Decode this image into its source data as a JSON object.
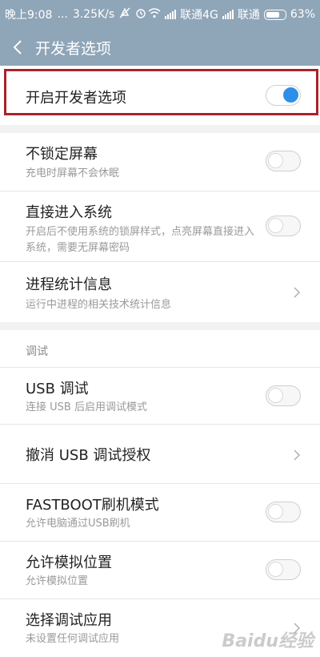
{
  "status_bar": {
    "time": "晚上9:08",
    "dots": "...",
    "speed": "3.25K/s",
    "carrier1": "联通4G",
    "carrier2": "联通",
    "battery": "63%"
  },
  "app_bar": {
    "title": "开发者选项"
  },
  "master_toggle": {
    "label": "开启开发者选项",
    "on": true
  },
  "items1": [
    {
      "title": "不锁定屏幕",
      "subtitle": "充电时屏幕不会休眠",
      "control": "toggle",
      "on": false
    },
    {
      "title": "直接进入系统",
      "subtitle": "开启后不使用系统的锁屏样式，点亮屏幕直接进入系统，需要无屏幕密码",
      "control": "toggle",
      "on": false
    },
    {
      "title": "进程统计信息",
      "subtitle": "运行中进程的相关技术统计信息",
      "control": "chevron"
    }
  ],
  "section_debug": {
    "label": "调试"
  },
  "items2": [
    {
      "title": "USB 调试",
      "subtitle": "连接 USB 后启用调试模式",
      "control": "toggle",
      "on": false
    },
    {
      "title": "撤消 USB 调试授权",
      "subtitle": "",
      "control": "chevron"
    },
    {
      "title": "FASTBOOT刷机模式",
      "subtitle": "允许电脑通过USB刷机",
      "control": "toggle",
      "on": false
    },
    {
      "title": "允许模拟位置",
      "subtitle": "允许模拟位置",
      "control": "toggle",
      "on": false
    },
    {
      "title": "选择调试应用",
      "subtitle": "未设置任何调试应用",
      "control": "chevron"
    }
  ],
  "watermark": "Baidu经验",
  "colors": {
    "header": "#8fa5b8",
    "toggle_on": "#2f8fe8",
    "highlight": "#a8232a"
  }
}
